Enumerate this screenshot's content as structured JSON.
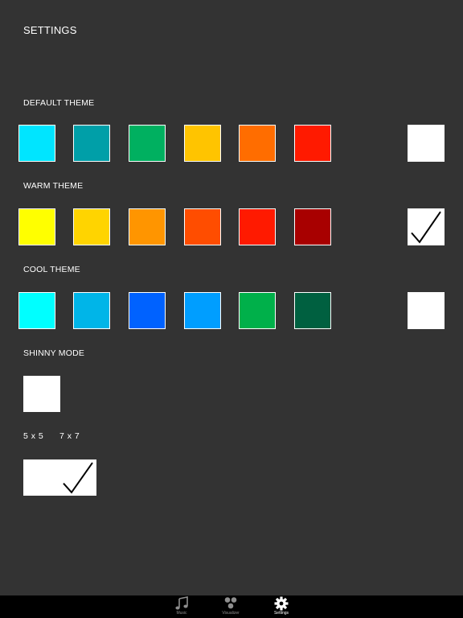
{
  "header": {
    "title": "SETTINGS"
  },
  "themes": [
    {
      "label": "DEFAULT THEME",
      "colors": [
        "#00E5FF",
        "#009FA8",
        "#00B060",
        "#FFC400",
        "#FF6D00",
        "#FF1A00"
      ],
      "selected": false
    },
    {
      "label": "WARM THEME",
      "colors": [
        "#FFFF00",
        "#FFD400",
        "#FF9500",
        "#FF4D00",
        "#FF1A00",
        "#A80000"
      ],
      "selected": true
    },
    {
      "label": "COOL THEME",
      "colors": [
        "#00FFFF",
        "#00B5E8",
        "#0062FF",
        "#009EFF",
        "#00B04A",
        "#006040"
      ],
      "selected": false
    }
  ],
  "shinny_mode": {
    "label": "SHINNY MODE",
    "checked": false
  },
  "grid_size": {
    "option_5x5": "5 x 5",
    "option_7x7": "7 x 7",
    "checked": true
  },
  "tabbar": {
    "items": [
      {
        "label": "Music",
        "icon": "music-note-icon",
        "active": false
      },
      {
        "label": "Visualizer",
        "icon": "three-dots-icon",
        "active": false
      },
      {
        "label": "Settings",
        "icon": "gear-icon",
        "active": true
      }
    ]
  }
}
